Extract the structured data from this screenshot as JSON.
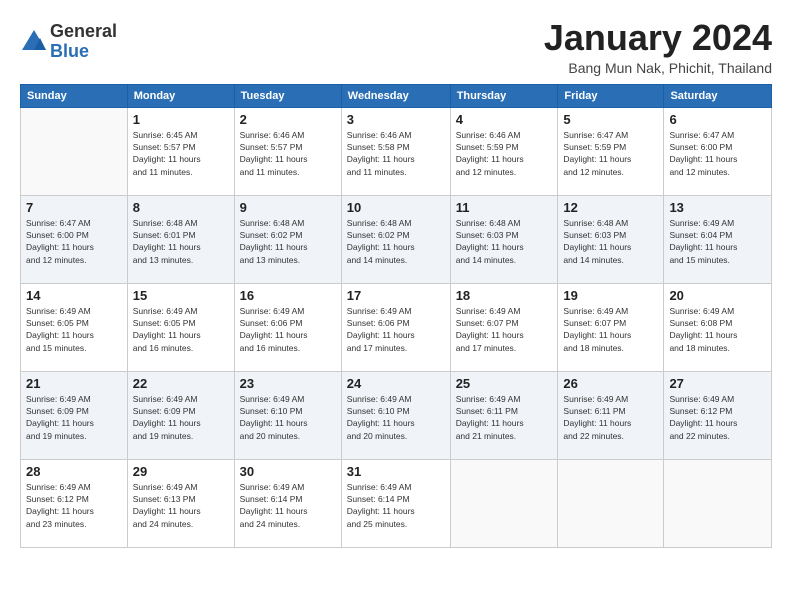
{
  "header": {
    "logo": {
      "general": "General",
      "blue": "Blue"
    },
    "title": "January 2024",
    "location": "Bang Mun Nak, Phichit, Thailand"
  },
  "days_of_week": [
    "Sunday",
    "Monday",
    "Tuesday",
    "Wednesday",
    "Thursday",
    "Friday",
    "Saturday"
  ],
  "weeks": [
    [
      {
        "num": "",
        "info": ""
      },
      {
        "num": "1",
        "info": "Sunrise: 6:45 AM\nSunset: 5:57 PM\nDaylight: 11 hours\nand 11 minutes."
      },
      {
        "num": "2",
        "info": "Sunrise: 6:46 AM\nSunset: 5:57 PM\nDaylight: 11 hours\nand 11 minutes."
      },
      {
        "num": "3",
        "info": "Sunrise: 6:46 AM\nSunset: 5:58 PM\nDaylight: 11 hours\nand 11 minutes."
      },
      {
        "num": "4",
        "info": "Sunrise: 6:46 AM\nSunset: 5:59 PM\nDaylight: 11 hours\nand 12 minutes."
      },
      {
        "num": "5",
        "info": "Sunrise: 6:47 AM\nSunset: 5:59 PM\nDaylight: 11 hours\nand 12 minutes."
      },
      {
        "num": "6",
        "info": "Sunrise: 6:47 AM\nSunset: 6:00 PM\nDaylight: 11 hours\nand 12 minutes."
      }
    ],
    [
      {
        "num": "7",
        "info": "Sunrise: 6:47 AM\nSunset: 6:00 PM\nDaylight: 11 hours\nand 12 minutes."
      },
      {
        "num": "8",
        "info": "Sunrise: 6:48 AM\nSunset: 6:01 PM\nDaylight: 11 hours\nand 13 minutes."
      },
      {
        "num": "9",
        "info": "Sunrise: 6:48 AM\nSunset: 6:02 PM\nDaylight: 11 hours\nand 13 minutes."
      },
      {
        "num": "10",
        "info": "Sunrise: 6:48 AM\nSunset: 6:02 PM\nDaylight: 11 hours\nand 14 minutes."
      },
      {
        "num": "11",
        "info": "Sunrise: 6:48 AM\nSunset: 6:03 PM\nDaylight: 11 hours\nand 14 minutes."
      },
      {
        "num": "12",
        "info": "Sunrise: 6:48 AM\nSunset: 6:03 PM\nDaylight: 11 hours\nand 14 minutes."
      },
      {
        "num": "13",
        "info": "Sunrise: 6:49 AM\nSunset: 6:04 PM\nDaylight: 11 hours\nand 15 minutes."
      }
    ],
    [
      {
        "num": "14",
        "info": "Sunrise: 6:49 AM\nSunset: 6:05 PM\nDaylight: 11 hours\nand 15 minutes."
      },
      {
        "num": "15",
        "info": "Sunrise: 6:49 AM\nSunset: 6:05 PM\nDaylight: 11 hours\nand 16 minutes."
      },
      {
        "num": "16",
        "info": "Sunrise: 6:49 AM\nSunset: 6:06 PM\nDaylight: 11 hours\nand 16 minutes."
      },
      {
        "num": "17",
        "info": "Sunrise: 6:49 AM\nSunset: 6:06 PM\nDaylight: 11 hours\nand 17 minutes."
      },
      {
        "num": "18",
        "info": "Sunrise: 6:49 AM\nSunset: 6:07 PM\nDaylight: 11 hours\nand 17 minutes."
      },
      {
        "num": "19",
        "info": "Sunrise: 6:49 AM\nSunset: 6:07 PM\nDaylight: 11 hours\nand 18 minutes."
      },
      {
        "num": "20",
        "info": "Sunrise: 6:49 AM\nSunset: 6:08 PM\nDaylight: 11 hours\nand 18 minutes."
      }
    ],
    [
      {
        "num": "21",
        "info": "Sunrise: 6:49 AM\nSunset: 6:09 PM\nDaylight: 11 hours\nand 19 minutes."
      },
      {
        "num": "22",
        "info": "Sunrise: 6:49 AM\nSunset: 6:09 PM\nDaylight: 11 hours\nand 19 minutes."
      },
      {
        "num": "23",
        "info": "Sunrise: 6:49 AM\nSunset: 6:10 PM\nDaylight: 11 hours\nand 20 minutes."
      },
      {
        "num": "24",
        "info": "Sunrise: 6:49 AM\nSunset: 6:10 PM\nDaylight: 11 hours\nand 20 minutes."
      },
      {
        "num": "25",
        "info": "Sunrise: 6:49 AM\nSunset: 6:11 PM\nDaylight: 11 hours\nand 21 minutes."
      },
      {
        "num": "26",
        "info": "Sunrise: 6:49 AM\nSunset: 6:11 PM\nDaylight: 11 hours\nand 22 minutes."
      },
      {
        "num": "27",
        "info": "Sunrise: 6:49 AM\nSunset: 6:12 PM\nDaylight: 11 hours\nand 22 minutes."
      }
    ],
    [
      {
        "num": "28",
        "info": "Sunrise: 6:49 AM\nSunset: 6:12 PM\nDaylight: 11 hours\nand 23 minutes."
      },
      {
        "num": "29",
        "info": "Sunrise: 6:49 AM\nSunset: 6:13 PM\nDaylight: 11 hours\nand 24 minutes."
      },
      {
        "num": "30",
        "info": "Sunrise: 6:49 AM\nSunset: 6:14 PM\nDaylight: 11 hours\nand 24 minutes."
      },
      {
        "num": "31",
        "info": "Sunrise: 6:49 AM\nSunset: 6:14 PM\nDaylight: 11 hours\nand 25 minutes."
      },
      {
        "num": "",
        "info": ""
      },
      {
        "num": "",
        "info": ""
      },
      {
        "num": "",
        "info": ""
      }
    ]
  ]
}
